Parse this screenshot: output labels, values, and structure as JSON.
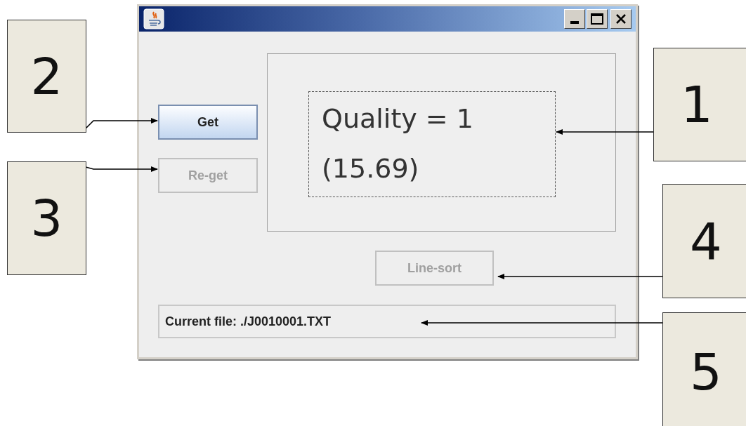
{
  "window": {
    "buttons": [
      {
        "label": "Get",
        "disabled": false
      },
      {
        "label": "Re-get",
        "disabled": true
      }
    ],
    "result_lines": [
      "Quality = 1",
      "(15.69)"
    ],
    "sort_button": {
      "label": "Line-sort",
      "disabled": true
    },
    "status": "Current file: ./J0010001.TXT"
  },
  "callouts": [
    {
      "label": "2"
    },
    {
      "label": "3"
    },
    {
      "label": "1"
    },
    {
      "label": "4"
    },
    {
      "label": "5"
    }
  ]
}
